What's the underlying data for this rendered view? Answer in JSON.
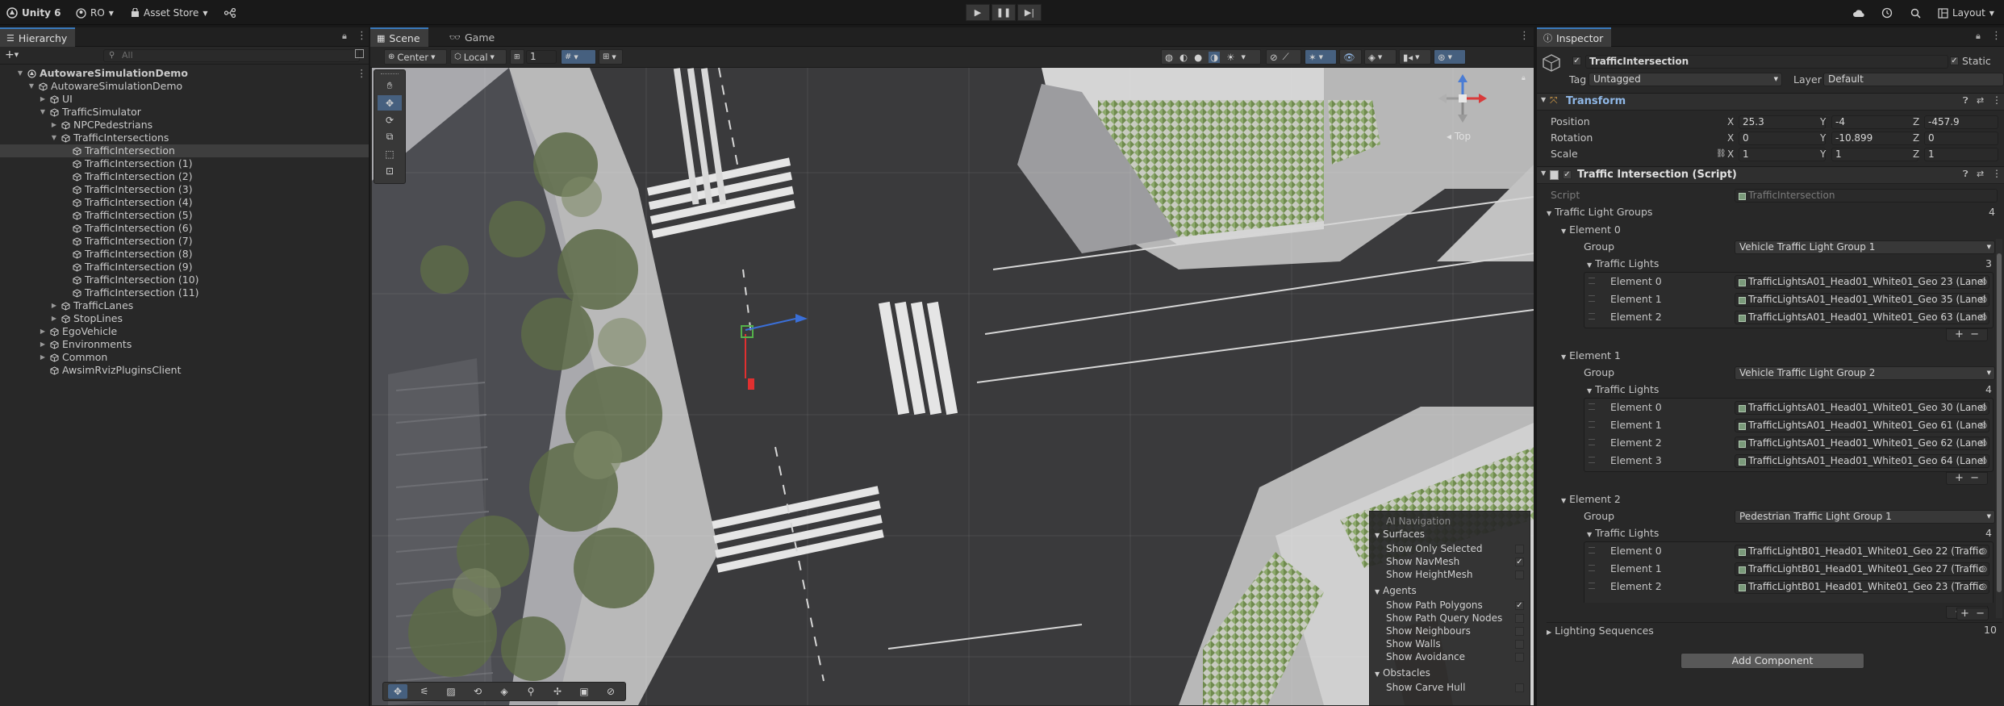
{
  "topbar": {
    "app": "Unity 6",
    "account": "RO",
    "asset_store": "Asset Store",
    "layout": "Layout"
  },
  "hierarchy": {
    "tab": "Hierarchy",
    "search_placeholder": "All",
    "rows": [
      {
        "label": "AutowareSimulationDemo",
        "indent": 0,
        "arrow": "down",
        "kind": "scene",
        "selected": false
      },
      {
        "label": "AutowareSimulationDemo",
        "indent": 1,
        "arrow": "down",
        "kind": "go",
        "selected": false
      },
      {
        "label": "UI",
        "indent": 2,
        "arrow": "right",
        "kind": "go",
        "selected": false
      },
      {
        "label": "TrafficSimulator",
        "indent": 2,
        "arrow": "down",
        "kind": "go",
        "selected": false
      },
      {
        "label": "NPCPedestrians",
        "indent": 3,
        "arrow": "right",
        "kind": "go",
        "selected": false
      },
      {
        "label": "TrafficIntersections",
        "indent": 3,
        "arrow": "down",
        "kind": "go",
        "selected": false
      },
      {
        "label": "TrafficIntersection",
        "indent": 4,
        "arrow": "",
        "kind": "go",
        "selected": true
      },
      {
        "label": "TrafficIntersection (1)",
        "indent": 4,
        "arrow": "",
        "kind": "go",
        "selected": false
      },
      {
        "label": "TrafficIntersection (2)",
        "indent": 4,
        "arrow": "",
        "kind": "go",
        "selected": false
      },
      {
        "label": "TrafficIntersection (3)",
        "indent": 4,
        "arrow": "",
        "kind": "go",
        "selected": false
      },
      {
        "label": "TrafficIntersection (4)",
        "indent": 4,
        "arrow": "",
        "kind": "go",
        "selected": false
      },
      {
        "label": "TrafficIntersection (5)",
        "indent": 4,
        "arrow": "",
        "kind": "go",
        "selected": false
      },
      {
        "label": "TrafficIntersection (6)",
        "indent": 4,
        "arrow": "",
        "kind": "go",
        "selected": false
      },
      {
        "label": "TrafficIntersection (7)",
        "indent": 4,
        "arrow": "",
        "kind": "go",
        "selected": false
      },
      {
        "label": "TrafficIntersection (8)",
        "indent": 4,
        "arrow": "",
        "kind": "go",
        "selected": false
      },
      {
        "label": "TrafficIntersection (9)",
        "indent": 4,
        "arrow": "",
        "kind": "go",
        "selected": false
      },
      {
        "label": "TrafficIntersection (10)",
        "indent": 4,
        "arrow": "",
        "kind": "go",
        "selected": false
      },
      {
        "label": "TrafficIntersection (11)",
        "indent": 4,
        "arrow": "",
        "kind": "go",
        "selected": false
      },
      {
        "label": "TrafficLanes",
        "indent": 3,
        "arrow": "right",
        "kind": "go",
        "selected": false
      },
      {
        "label": "StopLines",
        "indent": 3,
        "arrow": "right",
        "kind": "go",
        "selected": false
      },
      {
        "label": "EgoVehicle",
        "indent": 2,
        "arrow": "right",
        "kind": "go",
        "selected": false
      },
      {
        "label": "Environments",
        "indent": 2,
        "arrow": "right",
        "kind": "go",
        "selected": false
      },
      {
        "label": "Common",
        "indent": 2,
        "arrow": "right",
        "kind": "go",
        "selected": false
      },
      {
        "label": "AwsimRvizPluginsClient",
        "indent": 2,
        "arrow": "",
        "kind": "go",
        "selected": false
      }
    ]
  },
  "scene": {
    "tab_scene": "Scene",
    "tab_game": "Game",
    "pivot": "Center",
    "space": "Local",
    "snap": "1",
    "gizmo_view": "Top",
    "ai_nav": {
      "title": "AI Navigation",
      "surfaces_label": "Surfaces",
      "show_only_selected": "Show Only Selected",
      "show_navmesh": "Show NavMesh",
      "show_heightmesh": "Show HeightMesh",
      "agents_label": "Agents",
      "show_path_polygons": "Show Path Polygons",
      "show_path_query_nodes": "Show Path Query Nodes",
      "show_neighbours": "Show Neighbours",
      "show_walls": "Show Walls",
      "show_avoidance": "Show Avoidance",
      "obstacles_label": "Obstacles",
      "show_carve_hull": "Show Carve Hull"
    }
  },
  "inspector": {
    "tab": "Inspector",
    "object_name": "TrafficIntersection",
    "static_label": "Static",
    "tag_label": "Tag",
    "tag_value": "Untagged",
    "layer_label": "Layer",
    "layer_value": "Default",
    "transform": {
      "title": "Transform",
      "position_label": "Position",
      "rotation_label": "Rotation",
      "scale_label": "Scale",
      "x": "X",
      "y": "Y",
      "z": "Z",
      "position": [
        "25.3",
        "-4",
        "-457.9"
      ],
      "rotation": [
        "0",
        "-10.899",
        "0"
      ],
      "scale": [
        "1",
        "1",
        "1"
      ]
    },
    "script_component": {
      "title": "Traffic Intersection (Script)",
      "script_label": "Script",
      "script_value": "TrafficIntersection",
      "groups_label": "Traffic Light Groups",
      "groups_count": "4",
      "group_label": "Group",
      "lights_label": "Traffic Lights",
      "elements": [
        {
          "label": "Element 0",
          "group": "Vehicle Traffic Light Group 1",
          "count": "3",
          "lights": [
            {
              "label": "Element 0",
              "value": "TrafficLightsA01_Head01_White01_Geo 23 (Lanel"
            },
            {
              "label": "Element 1",
              "value": "TrafficLightsA01_Head01_White01_Geo 35 (Lanel"
            },
            {
              "label": "Element 2",
              "value": "TrafficLightsA01_Head01_White01_Geo 63 (Lanel"
            }
          ]
        },
        {
          "label": "Element 1",
          "group": "Vehicle Traffic Light Group 2",
          "count": "4",
          "lights": [
            {
              "label": "Element 0",
              "value": "TrafficLightsA01_Head01_White01_Geo 30 (Lanel"
            },
            {
              "label": "Element 1",
              "value": "TrafficLightsA01_Head01_White01_Geo 61 (Lanel"
            },
            {
              "label": "Element 2",
              "value": "TrafficLightsA01_Head01_White01_Geo 62 (Lanel"
            },
            {
              "label": "Element 3",
              "value": "TrafficLightsA01_Head01_White01_Geo 64 (Lanel"
            }
          ]
        },
        {
          "label": "Element 2",
          "group": "Pedestrian Traffic Light Group 1",
          "count": "4",
          "lights": [
            {
              "label": "Element 0",
              "value": "TrafficLightB01_Head01_White01_Geo 22 (Traffic"
            },
            {
              "label": "Element 1",
              "value": "TrafficLightB01_Head01_White01_Geo 27 (Traffic"
            },
            {
              "label": "Element 2",
              "value": "TrafficLightB01_Head01_White01_Geo 23 (Traffic"
            }
          ]
        }
      ],
      "lighting_label": "Lighting Sequences",
      "lighting_count": "10"
    },
    "add_component": "Add Component"
  }
}
